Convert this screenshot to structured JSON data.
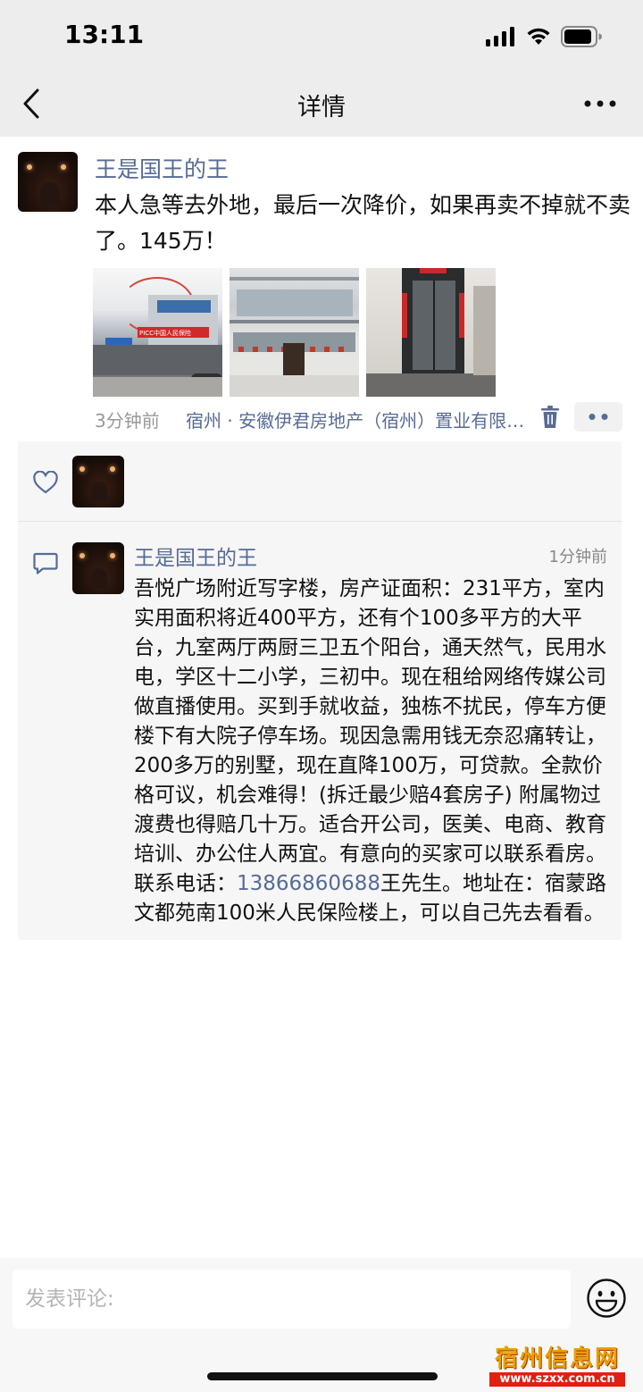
{
  "status_bar": {
    "time": "13:11"
  },
  "nav": {
    "title": "详情"
  },
  "post": {
    "author": "王是国王的王",
    "text": "本人急等去外地，最后一次降价，如果再卖不掉就不卖了。145万！",
    "time": "3分钟前",
    "location": "宿州 · 安徽伊君房地产（宿州）置业有限公司",
    "image1_sign": "PICC中国人民保险"
  },
  "comment": {
    "author": "王是国王的王",
    "time": "1分钟前",
    "text_before_phone": "吾悦广场附近写字楼，房产证面积：231平方，室内实用面积将近400平方，还有个100多平方的大平台，九室两厅两厨三卫五个阳台，通天然气，民用水电，学区十二小学，三初中。现在租给网络传媒公司做直播使用。买到手就收益，独栋不扰民，停车方便楼下有大院子停车场。现因急需用钱无奈忍痛转让，200多万的别墅，现在直降100万，可贷款。全款价格可议，机会难得！(拆迁最少赔4套房子) 附属物过渡费也得赔几十万。适合开公司，医美、电商、教育培训、办公住人两宜。有意向的买家可以联系看房。联系电话：",
    "phone": "13866860688",
    "text_after_phone": "王先生。地址在：宿蒙路文都苑南100米人民保险楼上，可以自己先去看看。"
  },
  "input": {
    "placeholder": "发表评论:"
  },
  "watermark": {
    "title": "宿州信息网",
    "url": "www.szxx.com.cn"
  },
  "colors": {
    "link": "#576b95",
    "panel_bg": "#f6f6f6",
    "nav_bg": "#ededed"
  },
  "icons": [
    "back-icon",
    "more-icon",
    "delete-icon",
    "action-dots-icon",
    "heart-icon",
    "comment-icon",
    "emoji-icon"
  ]
}
